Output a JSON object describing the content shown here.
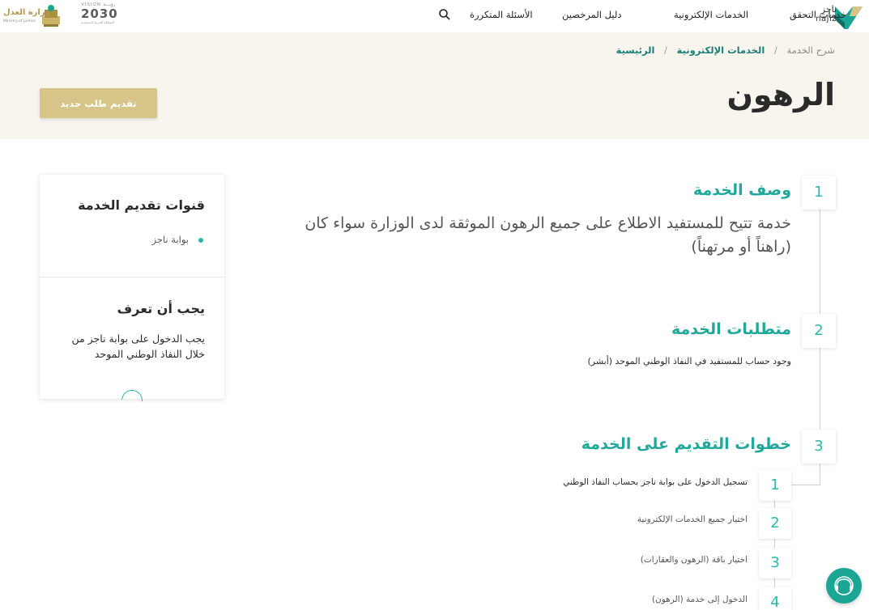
{
  "header": {
    "brand_ar": "ناجز",
    "brand_en": "najiz",
    "nav": [
      "خدمات التحقق",
      "الخدمات الإلكترونية",
      "دليل المرخصين",
      "الأسئلة المتكررة"
    ],
    "vision_small": "VISION رؤيـــة",
    "vision_year": "2030",
    "vision_caption": "المملكة العربية السعودية",
    "ministry_ar": "وزارة العدل",
    "ministry_en": "Ministry of Justice"
  },
  "breadcrumb": {
    "home": "الرئيسية",
    "eservices": "الخدمات الإلكترونية",
    "current": "شرح الخدمة",
    "separator": "/"
  },
  "page": {
    "title": "الرهون",
    "new_request_button": "تقديم طلب جديد"
  },
  "sidebar": {
    "channels_title": "قنوات تقديم الخدمة",
    "channels": [
      "بوابة ناجز"
    ],
    "know_title": "يجب أن تعرف",
    "know_text": "يجب الدخول على بوابة ناجز من خلال النفاذ الوطني الموحد"
  },
  "sections": [
    {
      "number": "1",
      "title": "وصف الخدمة",
      "description": "خدمة تتيح للمستفيد الاطلاع على جميع الرهون الموثقة لدى الوزارة سواء كان (راهناً أو مرتهناً)"
    },
    {
      "number": "2",
      "title": "متطلبات الخدمة",
      "description": "وجود حساب للمستفيد في النفاذ الوطني الموحد (أبشر)"
    },
    {
      "number": "3",
      "title": "خطوات التقديم على الخدمة",
      "steps": [
        {
          "number": "1",
          "text": "تسجيل الدخول على بوابة ناجز بحساب النفاذ الوطني"
        },
        {
          "number": "2",
          "text": "اختيار جميع الخدمات الإلكترونية"
        },
        {
          "number": "3",
          "text": "اختيار باقة (الرهون والعقارات)"
        },
        {
          "number": "4",
          "text": "الدخول إلى خدمة (الرهون)"
        }
      ]
    }
  ],
  "colors": {
    "accent": "#2ab8a9",
    "accent_dark": "#1c7f77",
    "gold_button": "#d6c489",
    "hero_bg": "#f8f5ee"
  },
  "icons": {
    "search": "search-icon",
    "support": "support-icon",
    "brand": "najiz-logo-icon",
    "ministry": "ministry-emblem-icon"
  }
}
